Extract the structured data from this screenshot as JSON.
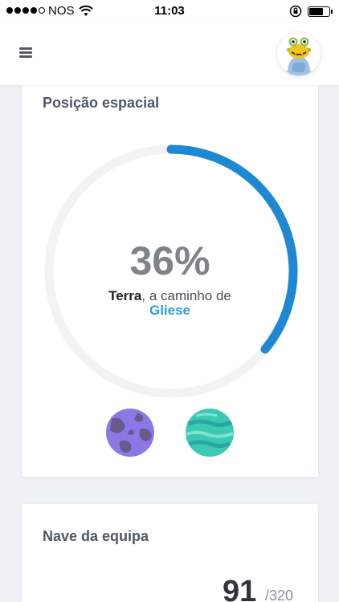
{
  "status_bar": {
    "carrier": "NOS",
    "time": "11:03",
    "battery_level": 0.75
  },
  "header": {
    "menu_icon": "hamburger-menu-icon",
    "avatar": "monster-avatar"
  },
  "position_card": {
    "title": "Posição espacial",
    "percent_label": "36%",
    "progress": 0.36,
    "origin": "Terra",
    "connector": ", a caminho de",
    "destination": "Gliese",
    "colors": {
      "accent": "#1e88d2",
      "track": "#f2f3f5",
      "destination_text": "#2e9fd8",
      "planet_origin": "#8b78e6",
      "planet_destination": "#3cc9b4"
    }
  },
  "team_card": {
    "title": "Nave da equipa",
    "count": "91",
    "total": "/320"
  }
}
